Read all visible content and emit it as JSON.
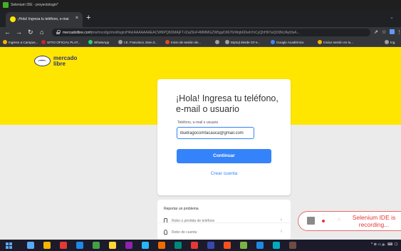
{
  "selenium_window": {
    "title": "Selenium IDE - proyectologin*"
  },
  "browser": {
    "tab_title": "¡Hola! Ingresa tu teléfono, e-mai",
    "tab_close": "×",
    "new_tab": "+",
    "tab_menu": "⌄",
    "back": "←",
    "forward": "→",
    "reload": "↻",
    "home": "⌂",
    "url_host": "mercadolibre.com",
    "url_path": "/jms/mco/lgz/msl/login/H4sIAAAAAAAEACWNPQ6DMAjFT-IZaZ6oF4MMMGZW5gsD0676rWqb6Dwh7nCyQhH97wQOtNLfAyt0sA...",
    "share": "⇗",
    "star": "☆",
    "more": "⋮"
  },
  "bookmarks": [
    {
      "label": "Ingreso a Campus...",
      "color": "#f2b400"
    },
    {
      "label": "SITIO OFICIAL PLAT...",
      "color": "#c62828"
    },
    {
      "label": "WhatsApp",
      "color": "#25d366"
    },
    {
      "label": "I.E. Francisco Jose d...",
      "color": "#9e9e9e"
    },
    {
      "label": "Inicio de sesión de...",
      "color": "#e64a19"
    },
    {
      "label": "",
      "color": "#9e9e9e"
    },
    {
      "label": "MySql desde C# e...",
      "color": "#9e9e9e"
    },
    {
      "label": "Google Académico",
      "color": "#4285f4"
    },
    {
      "label": "Iniciar sesión en tu...",
      "color": "#f4b400"
    },
    {
      "label": "Ing",
      "color": "#9e9e9e"
    }
  ],
  "logo": {
    "line1": "mercado",
    "line2": "libre"
  },
  "login": {
    "title": "¡Hola! Ingresa tu teléfono, e-mail o usuario",
    "field_label": "Teléfono, e-mail o usuario",
    "email_value": "lbuitragocomfacauca@gmail.com",
    "continue_label": "Continuar",
    "create_account_label": "Crear cuenta"
  },
  "report": {
    "title": "Reportar un problema",
    "items": [
      {
        "label": "Robo o pérdida de teléfono",
        "chevron": "›"
      },
      {
        "label": "Robo de cuenta",
        "chevron": "›"
      }
    ]
  },
  "selenium_pill": {
    "text": "Selenium IDE is recording...",
    "ghost": "A"
  },
  "taskbar": {
    "apps": [
      "#5aa9f0",
      "#f2b400",
      "#e53935",
      "#1e88e5",
      "#43a047",
      "#fdd835",
      "#8e24aa",
      "#29b6f6",
      "#ef6c00",
      "#00897b",
      "#e53935",
      "#3949ab",
      "#f4511e",
      "#7cb342",
      "#1e88e5",
      "#00acc1",
      "#6d4c41"
    ],
    "tray": "^ ⊕ ▭ 🔈 ⌨ 🗨"
  }
}
